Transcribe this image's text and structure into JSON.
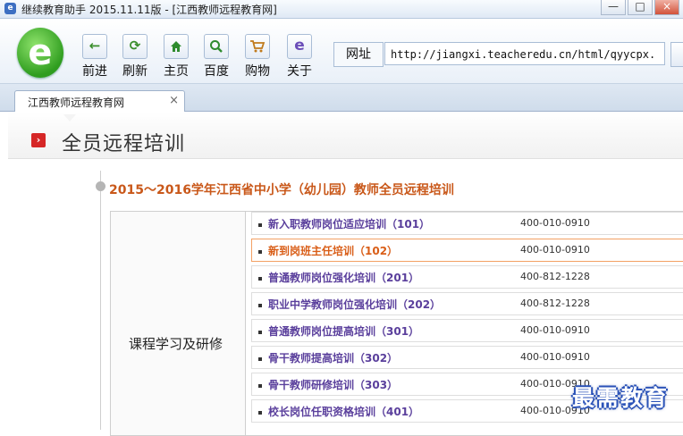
{
  "window": {
    "title": "继续教育助手 2015.11.11版 - [江西教师远程教育网]",
    "app_icon": "ie-icon",
    "controls": [
      "—",
      "□",
      "×"
    ]
  },
  "toolbar": {
    "buttons": [
      {
        "label": "前进",
        "icon": "arrow-left-icon",
        "glyph": "←",
        "color": "#3a8e2c"
      },
      {
        "label": "刷新",
        "icon": "refresh-icon",
        "glyph": "⟳",
        "color": "#3a8e2c"
      },
      {
        "label": "主页",
        "icon": "home-icon",
        "glyph": "⌂",
        "color": "#2e8b2e"
      },
      {
        "label": "百度",
        "icon": "search-icon",
        "glyph": "⚲",
        "color": "#2e8b2e"
      },
      {
        "label": "购物",
        "icon": "cart-icon",
        "glyph": "🛒",
        "color": "#c07a1c"
      },
      {
        "label": "关于",
        "icon": "ie-icon",
        "glyph": "e",
        "color": "#6b4db8"
      }
    ],
    "address_label": "网址",
    "address_value": "http://jiangxi.teacheredu.cn/html/qyycpx."
  },
  "tab": {
    "label": "江西教师远程教育网",
    "close": "×"
  },
  "page": {
    "title": "全员远程培训",
    "section_title": "2015～2016学年江西省中小学（幼儿园）教师全员远程培训",
    "category": "课程学习及研修",
    "courses": [
      {
        "name": "新入职教师岗位适应培训（101）",
        "phone": "400-010-0910",
        "active": false
      },
      {
        "name": "新到岗班主任培训（102）",
        "phone": "400-010-0910",
        "active": true
      },
      {
        "name": "普通教师岗位强化培训（201）",
        "phone": "400-812-1228",
        "active": false
      },
      {
        "name": "职业中学教师岗位强化培训（202）",
        "phone": "400-812-1228",
        "active": false
      },
      {
        "name": "普通教师岗位提高培训（301）",
        "phone": "400-010-0910",
        "active": false
      },
      {
        "name": "骨干教师提高培训（302）",
        "phone": "400-010-0910",
        "active": false
      },
      {
        "name": "骨干教师研修培训（303）",
        "phone": "400-010-0910",
        "active": false
      },
      {
        "name": "校长岗位任职资格培训（401）",
        "phone": "400-010-0910",
        "active": false
      }
    ]
  },
  "watermark": "最需教育"
}
